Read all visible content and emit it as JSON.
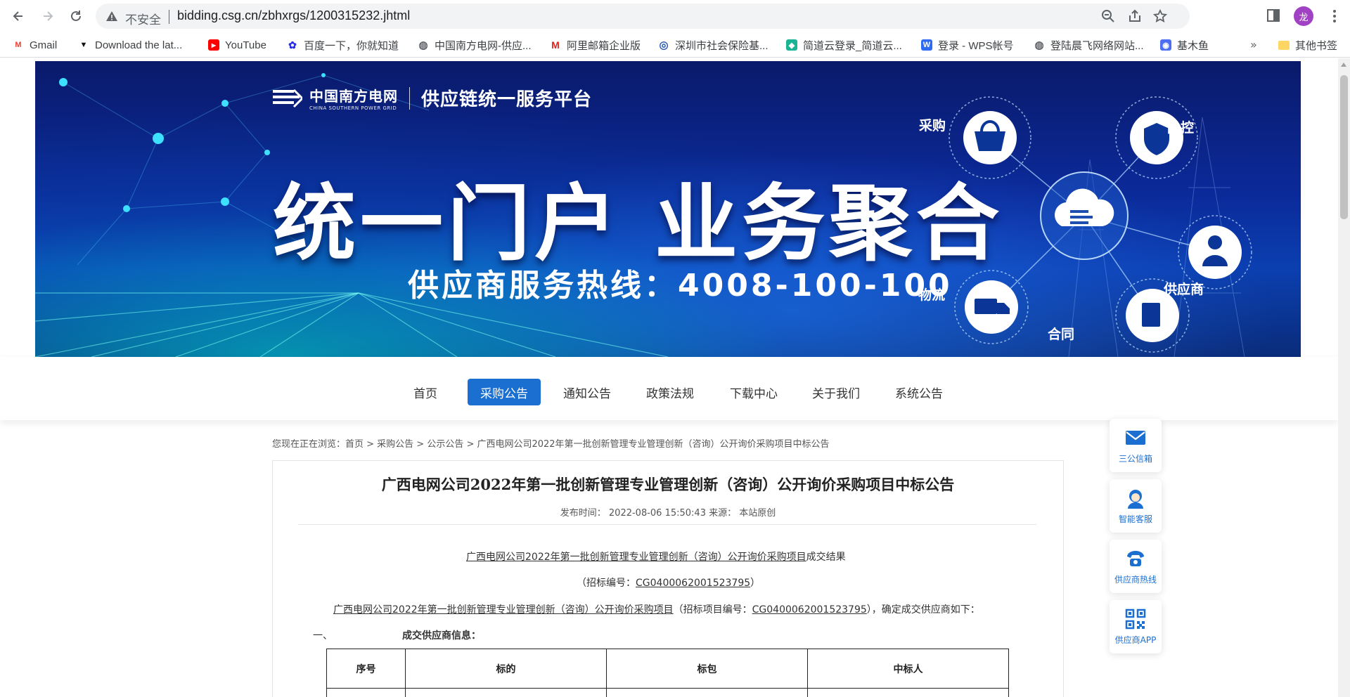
{
  "browser": {
    "insecure_label": "不安全",
    "url": "bidding.csg.cn/zbhxrgs/1200315232.jhtml",
    "profile_initial": "龙"
  },
  "bookmarks": [
    {
      "label": "Gmail",
      "icon": "gmail-icon",
      "color": "#ea4335",
      "glyph": "M"
    },
    {
      "label": "Download the lat...",
      "icon": "download-shield-icon",
      "color": "#111111",
      "glyph": "▼"
    },
    {
      "label": "YouTube",
      "icon": "youtube-icon",
      "color": "#ff0000",
      "glyph": "▶"
    },
    {
      "label": "百度一下，你就知道",
      "icon": "baidu-icon",
      "color": "#2932e1",
      "glyph": "✿"
    },
    {
      "label": "中国南方电网-供应...",
      "icon": "globe-icon",
      "color": "#5f6368",
      "glyph": "◍"
    },
    {
      "label": "阿里邮箱企业版",
      "icon": "aliyun-mail-icon",
      "color": "#e2231a",
      "glyph": "M"
    },
    {
      "label": "深圳市社会保险基...",
      "icon": "shenzhen-ss-icon",
      "color": "#2b5cb8",
      "glyph": "◎"
    },
    {
      "label": "简道云登录_简道云...",
      "icon": "jiandaoyun-icon",
      "color": "#1ab394",
      "glyph": "◆"
    },
    {
      "label": "登录 - WPS帐号",
      "icon": "wps-icon",
      "color": "#2f6bf2",
      "glyph": "W"
    },
    {
      "label": "登陆晨飞网络网站...",
      "icon": "globe-icon",
      "color": "#5f6368",
      "glyph": "◍"
    },
    {
      "label": "基木鱼",
      "icon": "jimuyu-icon",
      "color": "#4e6ef2",
      "glyph": "◉"
    }
  ],
  "bookmarks_more": "»",
  "bookmarks_other": "其他书签",
  "banner": {
    "logo_cn": "中国南方电网",
    "logo_en": "CHINA SOUTHERN POWER GRID",
    "platform": "供应链统一服务平台",
    "headline": "统一门户  业务聚合",
    "hotline": "供应商服务热线：4008-100-100",
    "hub_labels": {
      "purchase": "采购",
      "quality": "品控",
      "supplier": "供应商",
      "logistics": "物流",
      "contract": "合同"
    }
  },
  "nav": {
    "items": [
      "首页",
      "采购公告",
      "通知公告",
      "政策法规",
      "下载中心",
      "关于我们",
      "系统公告"
    ],
    "active_index": 1,
    "active_color": "#1a6fd0"
  },
  "breadcrumb": "您现在正在浏览：首页 > 采购公告 > 公示公告 > 广西电网公司2022年第一批创新管理专业管理创新（咨询）公开询价采购项目中标公告",
  "article": {
    "title": "广西电网公司2022年第一批创新管理专业管理创新（咨询）公开询价采购项目中标公告",
    "meta": "发布时间： 2022-08-06 15:50:43  来源： 本站原创",
    "result_heading_link": "广西电网公司2022年第一批创新管理专业管理创新（咨询）公开询价采购项目",
    "result_heading_suffix": "成交结果",
    "bid_no_prefix": "（招标编号：",
    "bid_no": "CG0400062001523795",
    "bid_no_suffix": "）",
    "para_link": "广西电网公司2022年第一批创新管理专业管理创新（咨询）公开询价采购项目",
    "para_mid": "（招标项目编号：",
    "para_bid_no": "CG0400062001523795",
    "para_suffix": "），确定成交供应商如下：",
    "section_num": "一、",
    "section_title": "成交供应商信息：",
    "table_headers": [
      "序号",
      "标的",
      "标包",
      "中标人"
    ]
  },
  "float_buttons": [
    {
      "label": "三公信箱",
      "icon": "mail-icon"
    },
    {
      "label": "智能客服",
      "icon": "customer-service-icon"
    },
    {
      "label": "供应商热线",
      "icon": "phone-icon"
    },
    {
      "label": "供应商APP",
      "icon": "qr-code-icon"
    }
  ]
}
